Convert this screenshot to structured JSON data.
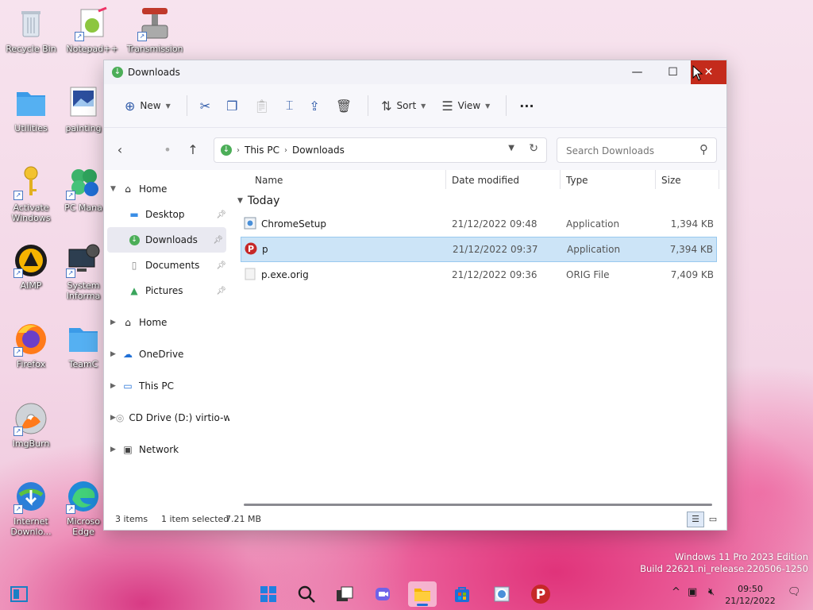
{
  "desktop": {
    "icons": [
      {
        "label": "Recycle Bin"
      },
      {
        "label": "Notepad++"
      },
      {
        "label": "Transmission"
      },
      {
        "label": "Utilities"
      },
      {
        "label": "painting"
      },
      {
        "label": "Activate Windows"
      },
      {
        "label": "PC Mana"
      },
      {
        "label": "AIMP"
      },
      {
        "label": "System Informa"
      },
      {
        "label": "Firefox"
      },
      {
        "label": "TeamC"
      },
      {
        "label": "ImgBurn"
      },
      {
        "label": "Internet Downlo..."
      },
      {
        "label": "Microso Edge"
      }
    ]
  },
  "window": {
    "title": "Downloads",
    "controls": {
      "minimize": "—",
      "maximize": "☐",
      "close": "✕"
    }
  },
  "ribbon": {
    "new_label": "New",
    "sort_label": "Sort",
    "view_label": "View",
    "more": "···"
  },
  "address": {
    "segments": [
      "This PC",
      "Downloads"
    ],
    "search_placeholder": "Search Downloads"
  },
  "sidebar": {
    "items": [
      {
        "label": "Home",
        "icon": "home-icon",
        "expanded": true
      },
      {
        "label": "Desktop",
        "icon": "desktop-icon",
        "pinned": true
      },
      {
        "label": "Downloads",
        "icon": "download-icon",
        "pinned": true,
        "selected": true
      },
      {
        "label": "Documents",
        "icon": "document-icon",
        "pinned": true
      },
      {
        "label": "Pictures",
        "icon": "pictures-icon",
        "pinned": true
      },
      {
        "label": "Home",
        "icon": "home-icon"
      },
      {
        "label": "OneDrive",
        "icon": "cloud-icon"
      },
      {
        "label": "This PC",
        "icon": "monitor-icon"
      },
      {
        "label": "CD Drive (D:) virtio-w",
        "icon": "cd-drive-icon"
      },
      {
        "label": "Network",
        "icon": "network-icon"
      }
    ]
  },
  "files": {
    "columns": {
      "name": "Name",
      "date": "Date modified",
      "type": "Type",
      "size": "Size"
    },
    "group": "Today",
    "rows": [
      {
        "name": "ChromeSetup",
        "date": "21/12/2022 09:48",
        "type": "Application",
        "size": "1,394 KB",
        "icon": "chrome-setup-icon",
        "selected": false
      },
      {
        "name": "p",
        "date": "21/12/2022 09:37",
        "type": "Application",
        "size": "7,394 KB",
        "icon": "psiphon-icon",
        "selected": true
      },
      {
        "name": "p.exe.orig",
        "date": "21/12/2022 09:36",
        "type": "ORIG File",
        "size": "7,409 KB",
        "icon": "blank-file-icon",
        "selected": false
      }
    ]
  },
  "status": {
    "count": "3 items",
    "selection": "1 item selected",
    "size": "7.21 MB"
  },
  "watermark": {
    "line1": "Windows 11 Pro 2023 Edition",
    "line2": "Build 22621.ni_release.220506-1250"
  },
  "taskbar": {
    "time": "09:50",
    "date": "21/12/2022"
  },
  "colors": {
    "accent": "#1f6fd6",
    "close_red": "#c42b1c",
    "selection": "#cce4f7"
  }
}
